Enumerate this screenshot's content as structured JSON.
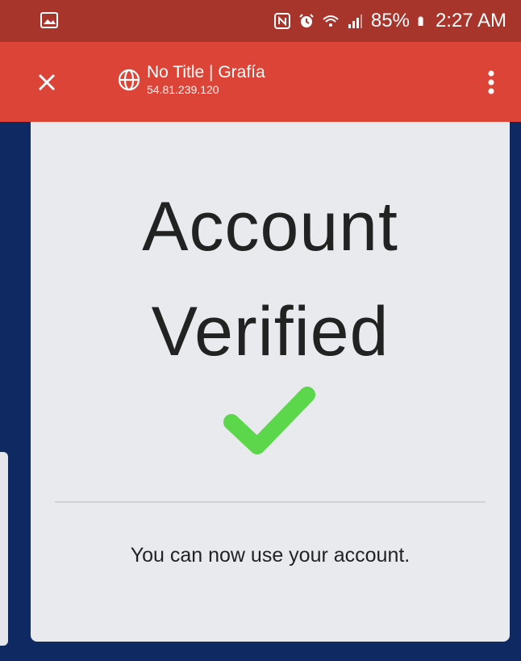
{
  "status_bar": {
    "battery_percent": "85%",
    "time": "2:27 AM",
    "icons": [
      "image-icon",
      "nfc-icon",
      "alarm-icon",
      "wifi-icon",
      "signal-icon",
      "battery-icon"
    ]
  },
  "toolbar": {
    "title": "No Title | Grafía",
    "url": "54.81.239.120",
    "icons": [
      "close-icon",
      "globe-icon",
      "more-vert-icon"
    ]
  },
  "content": {
    "heading_line1": "Account",
    "heading_line2": "Verified",
    "message": "You can now use your account.",
    "check_icon": "checkmark-icon"
  },
  "colors": {
    "status_bar": "#a7352b",
    "toolbar": "#db4437",
    "background": "#0f2a63",
    "card": "#e8eaed",
    "check": "#5cd64a"
  }
}
